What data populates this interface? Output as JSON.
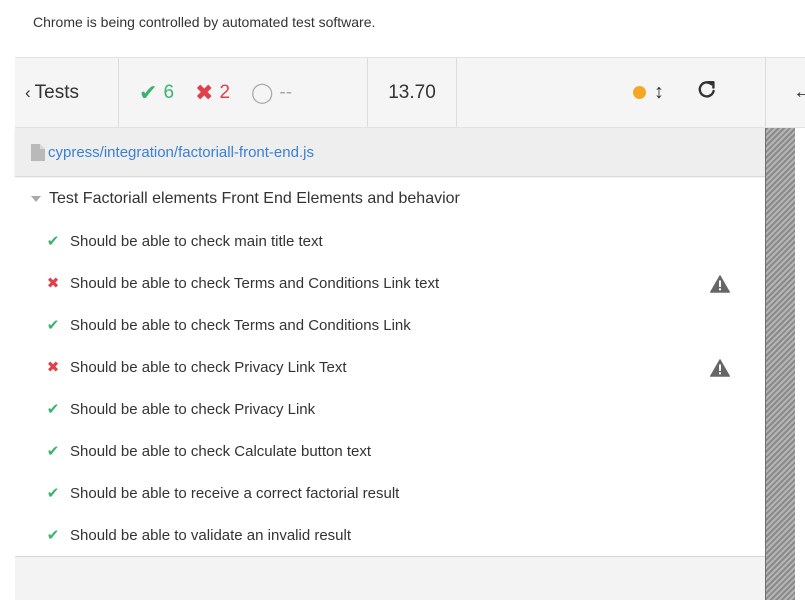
{
  "infobar": {
    "message": "Chrome is being controlled by automated test software."
  },
  "header": {
    "tests_label": "Tests",
    "tests_chevron": "‹",
    "passed_glyph": "✔",
    "passed_count": "6",
    "failed_glyph": "✖",
    "failed_count": "2",
    "pending_glyph": "◯",
    "pending_count": "--",
    "duration": "13.70",
    "updown_glyph": "↕",
    "reload_glyph": "C",
    "back_glyph": "←"
  },
  "spec": {
    "path": "cypress/integration/factoriall-front-end.js",
    "icon": "file-icon"
  },
  "suite": {
    "title": "Test Factoriall elements Front End Elements and behavior"
  },
  "tests": [
    {
      "state": "passed",
      "glyph": "✔",
      "title": "Should be able to check main title text"
    },
    {
      "state": "failed",
      "glyph": "✖",
      "title": "Should be able to check Terms and Conditions Link text"
    },
    {
      "state": "passed",
      "glyph": "✔",
      "title": "Should be able to check Terms and Conditions Link"
    },
    {
      "state": "failed",
      "glyph": "✖",
      "title": "Should be able to check Privacy Link Text"
    },
    {
      "state": "passed",
      "glyph": "✔",
      "title": "Should be able to check Privacy Link"
    },
    {
      "state": "passed",
      "glyph": "✔",
      "title": "Should be able to check Calculate button text"
    },
    {
      "state": "passed",
      "glyph": "✔",
      "title": "Should be able to receive a correct factorial result"
    },
    {
      "state": "passed",
      "glyph": "✔",
      "title": "Should be able to validate an invalid result"
    }
  ],
  "colors": {
    "passed": "#3cb371",
    "failed": "#e0404a",
    "running_dot": "#f5a623",
    "link": "#3b80d6"
  }
}
